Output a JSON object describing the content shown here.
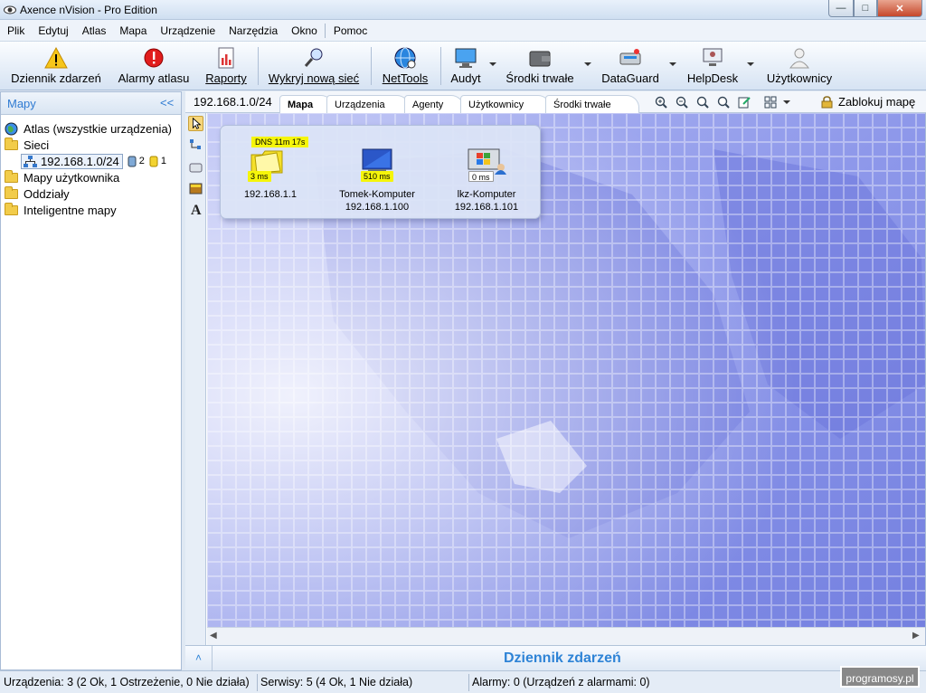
{
  "window": {
    "title": "Axence nVision - Pro Edition",
    "min": "—",
    "max": "□",
    "close": "✕"
  },
  "menu": [
    "Plik",
    "Edytuj",
    "Atlas",
    "Mapa",
    "Urządzenie",
    "Narzędzia",
    "Okno",
    "Pomoc"
  ],
  "toolbar": {
    "dziennik": "Dziennik zdarzeń",
    "alarmy": "Alarmy atlasu",
    "raporty": "Raporty",
    "wykryj": "Wykryj nową sieć",
    "nettools": "NetTools",
    "audyt": "Audyt",
    "srodki": "Środki trwałe",
    "dataguard": "DataGuard",
    "helpdesk": "HelpDesk",
    "uzytkownicy": "Użytkownicy"
  },
  "leftpanel": {
    "title": "Mapy",
    "collapse": "<<",
    "tree": {
      "atlas": "Atlas (wszystkie urządzenia)",
      "sieci": "Sieci",
      "subnet": "192.168.1.0/24",
      "subnet_ok": "2",
      "subnet_warn": "1",
      "mapy_uzytkownika": "Mapy użytkownika",
      "oddzialy": "Oddziały",
      "inteligentne": "Inteligentne mapy"
    }
  },
  "maptabs": {
    "current": "192.168.1.0/24",
    "tabs": [
      "Mapa",
      "Urządzenia",
      "Agenty",
      "Użytkownicy",
      "Środki trwałe"
    ],
    "lock": "Zablokuj mapę"
  },
  "devices": [
    {
      "name": "",
      "ip": "192.168.1.1",
      "ping": "3 ms",
      "badge": "DNS 11m 17s"
    },
    {
      "name": "Tomek-Komputer",
      "ip": "192.168.1.100",
      "ping": "510 ms"
    },
    {
      "name": "lkz-Komputer",
      "ip": "192.168.1.101",
      "ping": "0 ms"
    }
  ],
  "dziennik": {
    "label": "Dziennik zdarzeń",
    "expand": "˄"
  },
  "status": {
    "urzadzenia": "Urządzenia: 3 (2 Ok, 1 Ostrzeżenie, 0 Nie działa)",
    "serwisy": "Serwisy: 5 (4 Ok, 1 Nie działa)",
    "alarmy": "Alarmy: 0 (Urządzeń z alarmami: 0)"
  },
  "watermark": "programosy.pl",
  "colors": {
    "accent": "#2e83d6",
    "map_bg": "#7e8ae3",
    "warning": "#f5f50a"
  }
}
